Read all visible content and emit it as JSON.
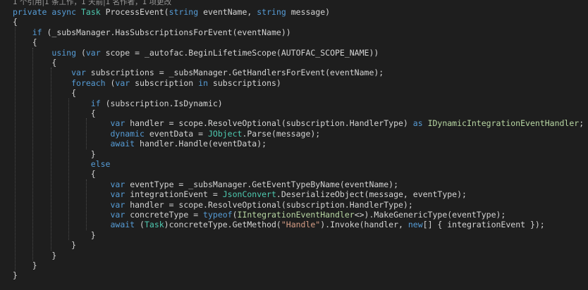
{
  "editor": {
    "theme_colors": {
      "background": "#1e1e1e",
      "keyword": "#569cd6",
      "type": "#4ec9b0",
      "interface": "#b8d7a3",
      "string": "#d69d85",
      "text": "#d4d4d4",
      "codelens": "#999999"
    },
    "codelens": "1 个引用|1 条工作，1 天前|1 名作者，1 项更改",
    "lines": [
      [
        [
          "kw",
          "private"
        ],
        [
          "id",
          " "
        ],
        [
          "kw",
          "async"
        ],
        [
          "id",
          " "
        ],
        [
          "ty",
          "Task"
        ],
        [
          "id",
          " ProcessEvent("
        ],
        [
          "kw",
          "string"
        ],
        [
          "id",
          " eventName, "
        ],
        [
          "kw",
          "string"
        ],
        [
          "id",
          " message)"
        ]
      ],
      [
        [
          "id",
          "{"
        ]
      ],
      [
        [
          "id",
          "    "
        ],
        [
          "kw",
          "if"
        ],
        [
          "id",
          " (_subsManager.HasSubscriptionsForEvent(eventName))"
        ]
      ],
      [
        [
          "id",
          "    {"
        ]
      ],
      [
        [
          "id",
          "        "
        ],
        [
          "kw",
          "using"
        ],
        [
          "id",
          " ("
        ],
        [
          "kw",
          "var"
        ],
        [
          "id",
          " scope = _autofac.BeginLifetimeScope(AUTOFAC_SCOPE_NAME))"
        ]
      ],
      [
        [
          "id",
          "        {"
        ]
      ],
      [
        [
          "id",
          "            "
        ],
        [
          "kw",
          "var"
        ],
        [
          "id",
          " subscriptions = _subsManager.GetHandlersForEvent(eventName);"
        ]
      ],
      [
        [
          "id",
          "            "
        ],
        [
          "kw",
          "foreach"
        ],
        [
          "id",
          " ("
        ],
        [
          "kw",
          "var"
        ],
        [
          "id",
          " subscription "
        ],
        [
          "kw",
          "in"
        ],
        [
          "id",
          " subscriptions)"
        ]
      ],
      [
        [
          "id",
          "            {"
        ]
      ],
      [
        [
          "id",
          "                "
        ],
        [
          "kw",
          "if"
        ],
        [
          "id",
          " (subscription.IsDynamic)"
        ]
      ],
      [
        [
          "id",
          "                {"
        ]
      ],
      [
        [
          "id",
          "                    "
        ],
        [
          "kw",
          "var"
        ],
        [
          "id",
          " handler = scope.ResolveOptional(subscription.HandlerType) "
        ],
        [
          "kw",
          "as"
        ],
        [
          "id",
          " "
        ],
        [
          "ifc",
          "IDynamicIntegrationEventHandler"
        ],
        [
          "id",
          ";"
        ]
      ],
      [
        [
          "id",
          "                    "
        ],
        [
          "kw",
          "dynamic"
        ],
        [
          "id",
          " eventData = "
        ],
        [
          "ty",
          "JObject"
        ],
        [
          "id",
          ".Parse(message);"
        ]
      ],
      [
        [
          "id",
          "                    "
        ],
        [
          "kw",
          "await"
        ],
        [
          "id",
          " handler.Handle(eventData);"
        ]
      ],
      [
        [
          "id",
          "                }"
        ]
      ],
      [
        [
          "id",
          "                "
        ],
        [
          "kw",
          "else"
        ]
      ],
      [
        [
          "id",
          "                {"
        ]
      ],
      [
        [
          "id",
          "                    "
        ],
        [
          "kw",
          "var"
        ],
        [
          "id",
          " eventType = _subsManager.GetEventTypeByName(eventName);"
        ]
      ],
      [
        [
          "id",
          "                    "
        ],
        [
          "kw",
          "var"
        ],
        [
          "id",
          " integrationEvent = "
        ],
        [
          "ty",
          "JsonConvert"
        ],
        [
          "id",
          ".DeserializeObject(message, eventType);"
        ]
      ],
      [
        [
          "id",
          "                    "
        ],
        [
          "kw",
          "var"
        ],
        [
          "id",
          " handler = scope.ResolveOptional(subscription.HandlerType);"
        ]
      ],
      [
        [
          "id",
          "                    "
        ],
        [
          "kw",
          "var"
        ],
        [
          "id",
          " concreteType = "
        ],
        [
          "kw",
          "typeof"
        ],
        [
          "id",
          "("
        ],
        [
          "ifc",
          "IIntegrationEventHandler"
        ],
        [
          "id",
          "<>).MakeGenericType(eventType);"
        ]
      ],
      [
        [
          "id",
          "                    "
        ],
        [
          "kw",
          "await"
        ],
        [
          "id",
          " ("
        ],
        [
          "ty",
          "Task"
        ],
        [
          "id",
          ")concreteType.GetMethod("
        ],
        [
          "str",
          "\"Handle\""
        ],
        [
          "id",
          ").Invoke(handler, "
        ],
        [
          "kw",
          "new"
        ],
        [
          "id",
          "[] { integrationEvent });"
        ]
      ],
      [
        [
          "id",
          "                }"
        ]
      ],
      [
        [
          "id",
          "            }"
        ]
      ],
      [
        [
          "id",
          "        }"
        ]
      ],
      [
        [
          "id",
          "    }"
        ]
      ],
      [
        [
          "id",
          "}"
        ]
      ]
    ]
  }
}
